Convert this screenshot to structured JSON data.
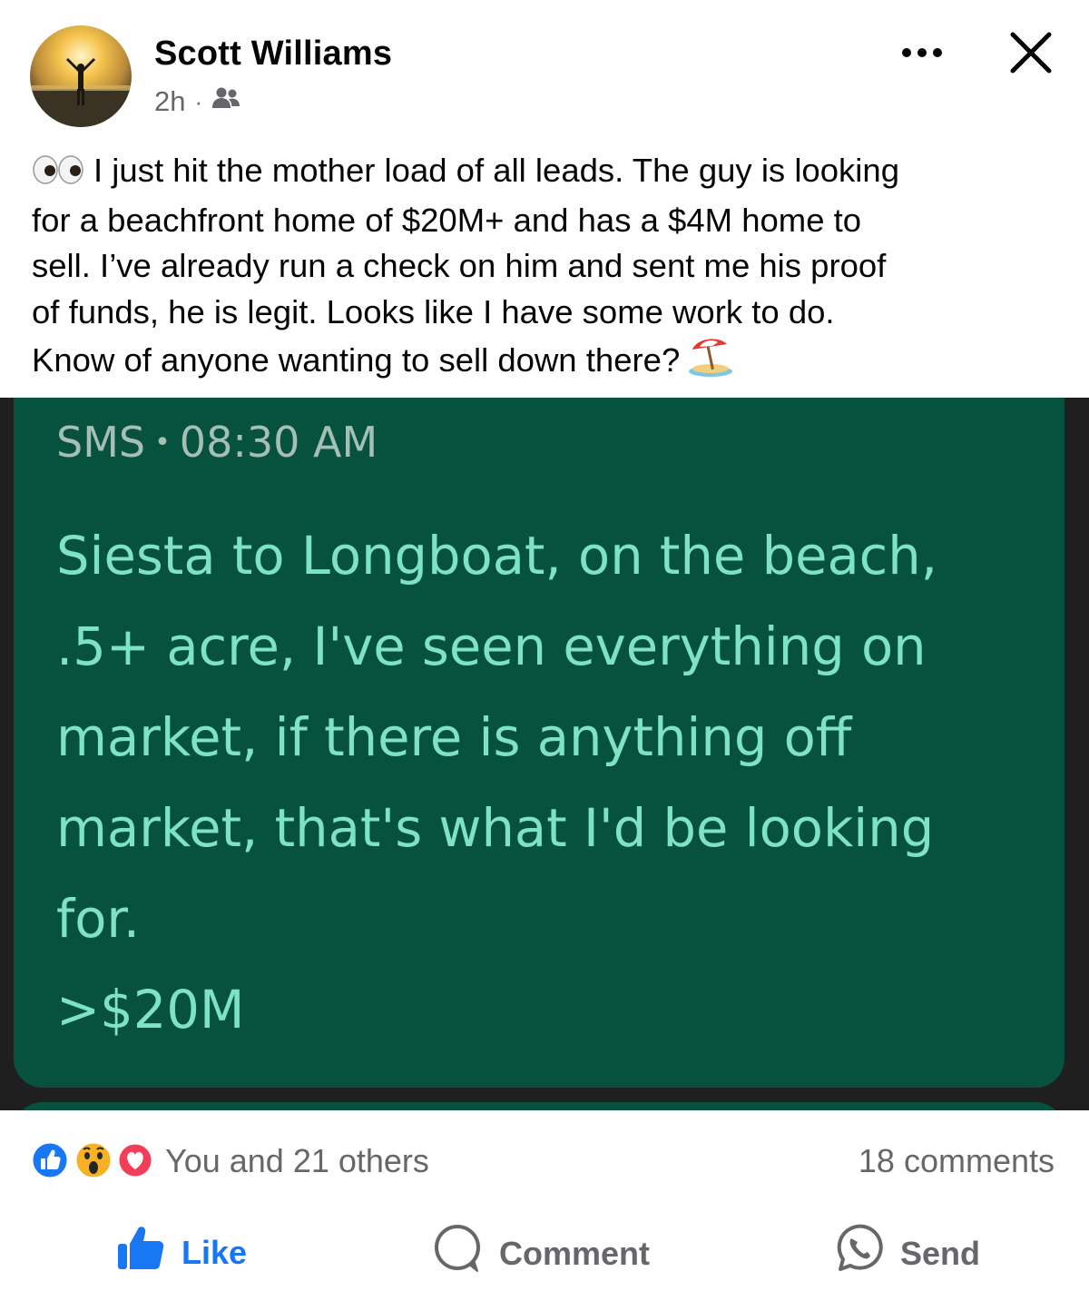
{
  "post": {
    "author": "Scott Williams",
    "time": "2h",
    "dot": "·",
    "audience_icon": "friends-icon",
    "caption": {
      "lines": [
        "I just hit the mother load of all leads. The guy is looking",
        "for a beachfront home of $20M+ and has a $4M home to",
        "sell. I’ve already run a check on him and sent me his proof",
        "of funds, he is legit. Looks like I have some work to do.",
        "Know of anyone wanting to sell down there?"
      ],
      "leading_emoji": "eyes-emoji",
      "trailing_emoji": "beach-umbrella-emoji"
    }
  },
  "screenshot": {
    "sms_label": "SMS",
    "separator": "•",
    "time": "08:30 AM",
    "message_lines": [
      "Siesta to Longboat, on the beach,",
      ".5+ acre, I've seen everything on",
      "market, if there is anything off",
      "market, that's what I'd be looking",
      "for.",
      ">$20M"
    ],
    "colors": {
      "bubble": "#07513f",
      "text": "#7de3c4",
      "header_text": "#a6bfb5",
      "background": "#1f1f1f"
    }
  },
  "engagement": {
    "reaction_icons": [
      "like-reaction-icon",
      "wow-reaction-icon",
      "love-reaction-icon"
    ],
    "reaction_text": "You and 21 others",
    "comments_text": "18 comments"
  },
  "actions": {
    "like": "Like",
    "comment": "Comment",
    "send": "Send",
    "like_color": "#1877f2"
  }
}
